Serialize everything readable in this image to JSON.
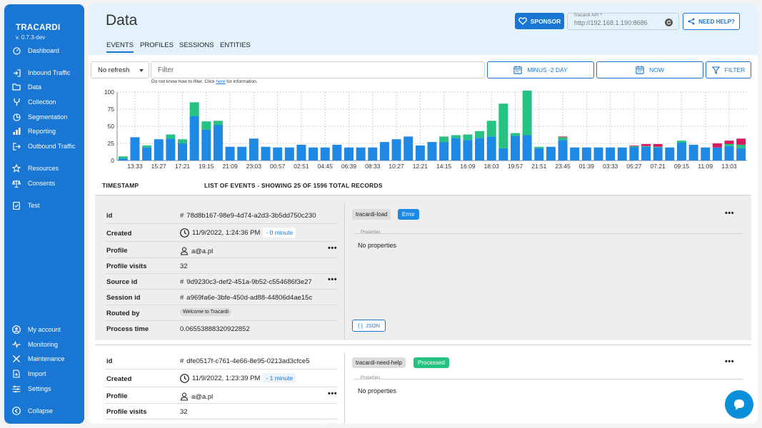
{
  "sidebar": {
    "brand": "TRACARDI",
    "version": "v. 0.7.3-dev",
    "items": [
      {
        "label": "Dashboard",
        "icon": "speedometer-icon"
      },
      {
        "label": "Inbound Traffic",
        "icon": "login-arrow-icon"
      },
      {
        "label": "Data",
        "icon": "folder-icon"
      },
      {
        "label": "Collection",
        "icon": "merge-icon"
      },
      {
        "label": "Segmentation",
        "icon": "pie-icon"
      },
      {
        "label": "Reporting",
        "icon": "bar-chart-icon"
      },
      {
        "label": "Outbound Traffic",
        "icon": "logout-arrow-icon"
      },
      {
        "label": "Resources",
        "icon": "star-icon"
      },
      {
        "label": "Consents",
        "icon": "scale-icon"
      },
      {
        "label": "Test",
        "icon": "clipboard-icon"
      },
      {
        "label": "My account",
        "icon": "account-icon"
      },
      {
        "label": "Monitoring",
        "icon": "pulse-icon"
      },
      {
        "label": "Maintenance",
        "icon": "tools-icon"
      },
      {
        "label": "Import",
        "icon": "import-icon"
      },
      {
        "label": "Settings",
        "icon": "sliders-icon"
      },
      {
        "label": "Collapse",
        "icon": "chevron-left-icon"
      }
    ]
  },
  "header": {
    "title": "Data",
    "tabs": [
      "EVENTS",
      "PROFILES",
      "SESSIONS",
      "ENTITIES"
    ],
    "sponsor_label": "SPONSOR",
    "api_label": "Tracardi API *",
    "api_value": "http://192.168.1.190:8686",
    "help_label": "NEED HELP?"
  },
  "filter": {
    "refresh": "No refresh",
    "placeholder": "Filter",
    "hint_prefix": "Do not know how to filter. Click ",
    "hint_link": "here",
    "hint_suffix": " for information.",
    "from_label": "MINUS -2 DAY",
    "to_label": "NOW",
    "filter_label": "FILTER"
  },
  "colors": {
    "accent": "#1976d2",
    "series_blue": "#1e88e5",
    "series_green": "#26c281",
    "series_red": "#d81b60",
    "error": "#1e88e5",
    "processed": "#26c281"
  },
  "chart_data": {
    "type": "bar",
    "stacked": true,
    "ylim": [
      0,
      100
    ],
    "yticks": [
      0,
      25,
      50,
      75,
      100
    ],
    "grid": true,
    "xtick_labels": [
      "13:33",
      "15:27",
      "17:21",
      "19:15",
      "21:09",
      "23:03",
      "00:57",
      "02:51",
      "04:45",
      "06:39",
      "08:33",
      "10:27",
      "12:21",
      "14:15",
      "16:09",
      "18:03",
      "19:57",
      "21:51",
      "23:45",
      "01:39",
      "03:33",
      "05:27",
      "07:21",
      "09:15",
      "11:09",
      "13:03"
    ],
    "series": [
      {
        "values": [
          3,
          34,
          19,
          31,
          32,
          25,
          65,
          45,
          52,
          20,
          20,
          32,
          20,
          19,
          19,
          23,
          19,
          19,
          23,
          19,
          19,
          19,
          27,
          31,
          35,
          22,
          27,
          27,
          33,
          30,
          33,
          35,
          18,
          36,
          37,
          18,
          20,
          30,
          19,
          19,
          19,
          19,
          19,
          20,
          20,
          19,
          19,
          26,
          23,
          19,
          19,
          21,
          18
        ]
      },
      {
        "values": [
          3,
          0,
          3,
          0,
          6,
          6,
          20,
          12,
          6,
          0,
          0,
          0,
          0,
          0,
          0,
          0,
          0,
          0,
          0,
          0,
          0,
          0,
          0,
          0,
          0,
          0,
          0,
          8,
          4,
          8,
          10,
          23,
          65,
          4,
          65,
          2,
          0,
          4,
          0,
          0,
          0,
          0,
          0,
          1,
          1,
          1,
          0,
          3,
          0,
          0,
          0,
          3,
          5
        ]
      },
      {
        "values": [
          0,
          0,
          0,
          0,
          0,
          0,
          0,
          0,
          0,
          0,
          0,
          0,
          0,
          0,
          0,
          0,
          0,
          0,
          0,
          0,
          0,
          0,
          0,
          0,
          0,
          0,
          0,
          0,
          0,
          0,
          0,
          0,
          0,
          0,
          0,
          0,
          0,
          1,
          0,
          0,
          0,
          0,
          0,
          1,
          3,
          4,
          0,
          0,
          0,
          0,
          6,
          5,
          9
        ]
      }
    ]
  },
  "table": {
    "col_timestamp": "TIMESTAMP",
    "col_events": "LIST OF EVENTS - SHOWING 25 OF 1596 TOTAL RECORDS",
    "labels": {
      "id": "id",
      "created": "Created",
      "profile": "Profile",
      "visits": "Profile visits",
      "source": "Source id",
      "session": "Session id",
      "routed": "Routed by",
      "process": "Process time"
    },
    "properties_label": "Properties",
    "no_properties": "No properties",
    "json_label": "JSON"
  },
  "events": [
    {
      "id": "78d8b167-98e9-4d74-a2d3-3b5dd750c230",
      "created": "11/9/2022, 1:24:36 PM",
      "relative": "- 0 minute",
      "profile": "a@a.pl",
      "visits": "32",
      "source": "9d9230c3-def2-451a-9b52-c554686f3e27",
      "session": "a969fa6e-3bfe-450d-ad88-44806d4ae15c",
      "routed": "Welcome to Tracardi",
      "process_time": "0.06553888320922852",
      "type": "tracardi-load",
      "status": "Error"
    },
    {
      "id": "dfe0517f-c761-4e66-8e95-0213ad3cfce5",
      "created": "11/9/2022, 1:23:39 PM",
      "relative": "- 1 minute",
      "profile": "a@a.pl",
      "visits": "32",
      "source": "9d9230c3-def2-451a-9b52-c554686f3e27",
      "type": "tracardi-need-help",
      "status": "Processed"
    }
  ]
}
